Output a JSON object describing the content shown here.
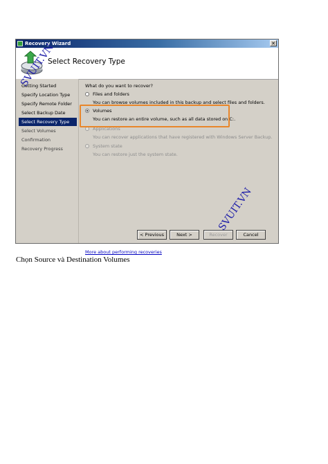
{
  "window": {
    "title": "Recovery Wizard",
    "close_label": "✕"
  },
  "header": {
    "page_title": "Select Recovery Type"
  },
  "sidebar": {
    "steps": [
      {
        "label": "Getting Started"
      },
      {
        "label": "Specify Location Type"
      },
      {
        "label": "Specify Remote Folder"
      },
      {
        "label": "Select Backup Date"
      },
      {
        "label": "Select Recovery Type",
        "active": true
      },
      {
        "label": "Select Volumes"
      },
      {
        "label": "Confirmation"
      },
      {
        "label": "Recovery Progress"
      }
    ]
  },
  "main": {
    "question": "What do you want to recover?",
    "options": [
      {
        "label": "Files and folders",
        "description": "You can browse volumes included in this backup and select files and folders.",
        "checked": false,
        "enabled": true
      },
      {
        "label": "Volumes",
        "description": "You can restore an entire volume, such as all data stored on C:.",
        "checked": true,
        "enabled": true
      },
      {
        "label": "Applications",
        "description": "You can recover applications that have registered with Windows Server Backup.",
        "checked": false,
        "enabled": false
      },
      {
        "label": "System state",
        "description": "You can restore just the system state.",
        "checked": false,
        "enabled": false
      }
    ],
    "more_link": "More about performing recoveries"
  },
  "buttons": {
    "previous": "< Previous",
    "next": "Next >",
    "recover": "Recover",
    "cancel": "Cancel"
  },
  "watermark": "SVUIT.VN",
  "caption": "Chọn Source và Destination Volumes",
  "colors": {
    "highlight": "#e8862a",
    "titlebar": "#0a246a",
    "watermark": "#1a1aa8"
  }
}
